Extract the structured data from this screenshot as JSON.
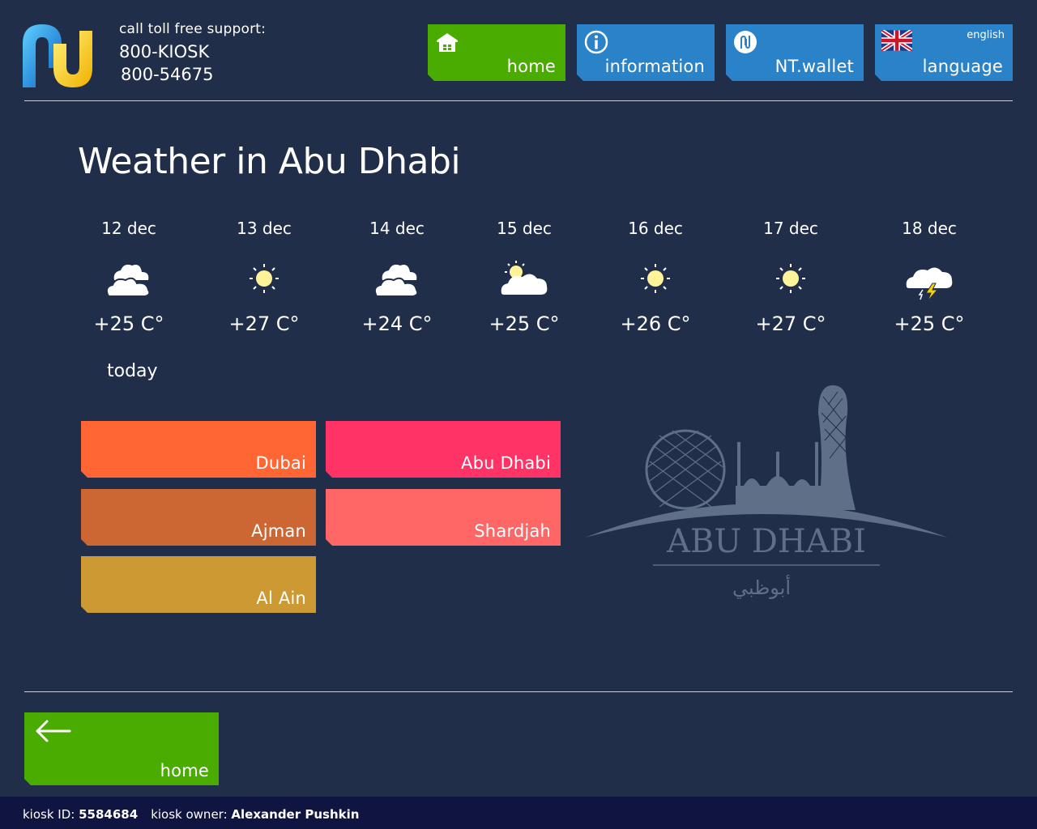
{
  "header": {
    "support_label": "call toll free support:",
    "phone_primary": "800-KIOSK",
    "phone_secondary": "800-54675"
  },
  "nav": {
    "home_label": "home",
    "information_label": "information",
    "wallet_label": "NT.wallet",
    "language_label": "language",
    "language_current": "english"
  },
  "page": {
    "title": "Weather in Abu Dhabi"
  },
  "forecast": [
    {
      "date": "12 dec",
      "icon": "cloudy-icon",
      "temp": "+25 C°"
    },
    {
      "date": "13 dec",
      "icon": "sunny-icon",
      "temp": "+27 C°"
    },
    {
      "date": "14 dec",
      "icon": "cloudy-icon",
      "temp": "+24 C°"
    },
    {
      "date": "15 dec",
      "icon": "partly-cloudy-icon",
      "temp": "+25 C°"
    },
    {
      "date": "16 dec",
      "icon": "sunny-icon",
      "temp": "+26 C°"
    },
    {
      "date": "17 dec",
      "icon": "sunny-icon",
      "temp": "+27 C°"
    },
    {
      "date": "18 dec",
      "icon": "thunderstorm-icon",
      "temp": "+25 C°"
    }
  ],
  "today_label": "today",
  "cities": [
    {
      "name": "Dubai",
      "color": "#ff6633"
    },
    {
      "name": "Abu Dhabi",
      "color": "#ff3366"
    },
    {
      "name": "Ajman",
      "color": "#cc6633"
    },
    {
      "name": "Shardjah",
      "color": "#ff6666"
    },
    {
      "name": "Al Ain",
      "color": "#cc9933"
    }
  ],
  "skyline": {
    "title": "ABU DHABI",
    "arabic": "أبوظبي"
  },
  "back": {
    "label": "home"
  },
  "footer": {
    "kiosk_id_label": "kiosk ID:",
    "kiosk_id": "5584684",
    "owner_label": "kiosk owner:",
    "owner": "Alexander Pushkin"
  },
  "colors": {
    "background": "#212e4a",
    "home_green": "#4aab00",
    "nav_blue": "#2a82c9",
    "footer_bg": "#0f1440"
  }
}
